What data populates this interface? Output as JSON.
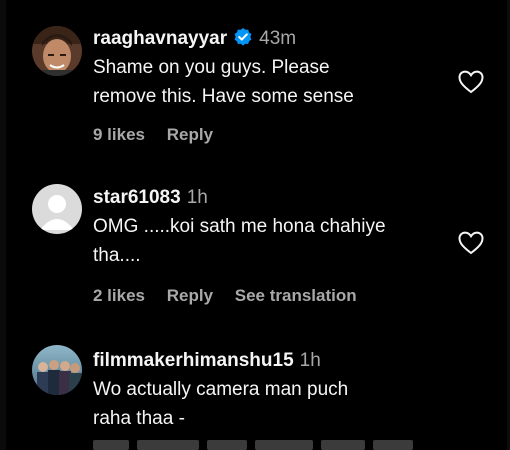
{
  "comments": [
    {
      "username": "raaghavnayyar",
      "verified": true,
      "time": "43m",
      "lines": [
        "Shame on you guys. Please",
        "remove this. Have some sense"
      ],
      "likes": "9 likes",
      "reply": "Reply",
      "icons": {
        "verified": "verified-badge-icon",
        "like": "heart-icon"
      }
    },
    {
      "username": "star61083",
      "verified": false,
      "time": "1h",
      "lines": [
        "OMG .....koi sath me hona chahiye",
        "tha...."
      ],
      "likes": "2 likes",
      "reply": "Reply",
      "translation": "See translation",
      "icons": {
        "avatar": "default-avatar-icon",
        "like": "heart-icon"
      }
    },
    {
      "username": "filmmakerhimanshu15",
      "verified": false,
      "time": "1h",
      "lines": [
        "Wo actually camera man puch",
        "raha thaa -"
      ],
      "icons": {
        "like": "heart-icon"
      }
    }
  ],
  "colors": {
    "background": "#000000",
    "primary_text": "#f5f5f5",
    "secondary_text": "#a8a8a8",
    "verified": "#0095f6"
  }
}
